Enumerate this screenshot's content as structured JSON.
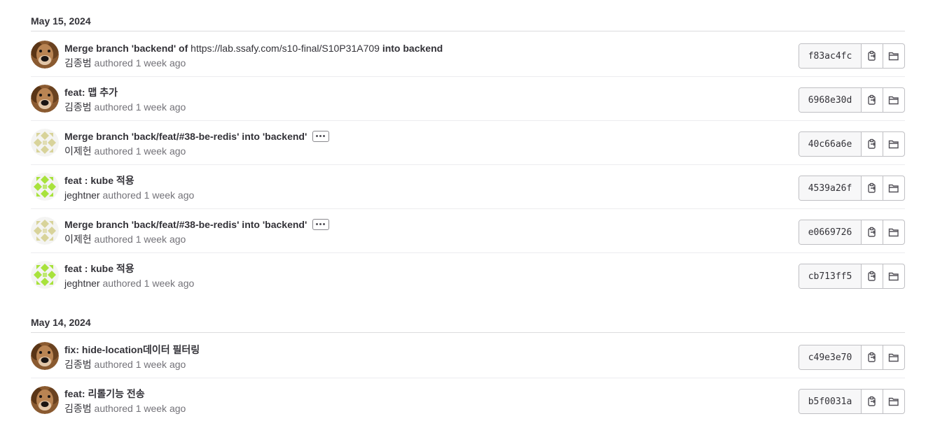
{
  "groups": [
    {
      "date": "May 15, 2024",
      "commits": [
        {
          "title_bold": "Merge branch 'backend' of",
          "title_link": "https://lab.ssafy.com/s10-final/S10P31A709",
          "title_tail": "into backend",
          "author": "김종범",
          "action": "authored",
          "time": "1 week ago",
          "sha": "f83ac4fc",
          "avatar": "dog-photo",
          "more_button": false
        },
        {
          "title_bold": "feat: 맵 추가",
          "title_link": "",
          "title_tail": "",
          "author": "김종범",
          "action": "authored",
          "time": "1 week ago",
          "sha": "6968e30d",
          "avatar": "dog-photo",
          "more_button": false
        },
        {
          "title_bold": "Merge branch 'back/feat/#38-be-redis' into 'backend'",
          "title_link": "",
          "title_tail": "",
          "author": "이제헌",
          "action": "authored",
          "time": "1 week ago",
          "sha": "40c66a6e",
          "avatar": "identicon-beige",
          "more_button": true
        },
        {
          "title_bold": "feat : kube 적용",
          "title_link": "",
          "title_tail": "",
          "author": "jeghtner",
          "action": "authored",
          "time": "1 week ago",
          "sha": "4539a26f",
          "avatar": "identicon-green",
          "more_button": false
        },
        {
          "title_bold": "Merge branch 'back/feat/#38-be-redis' into 'backend'",
          "title_link": "",
          "title_tail": "",
          "author": "이제헌",
          "action": "authored",
          "time": "1 week ago",
          "sha": "e0669726",
          "avatar": "identicon-beige",
          "more_button": true
        },
        {
          "title_bold": "feat : kube 적용",
          "title_link": "",
          "title_tail": "",
          "author": "jeghtner",
          "action": "authored",
          "time": "1 week ago",
          "sha": "cb713ff5",
          "avatar": "identicon-green",
          "more_button": false
        }
      ]
    },
    {
      "date": "May 14, 2024",
      "commits": [
        {
          "title_bold": "fix: hide-location데이터 필터링",
          "title_link": "",
          "title_tail": "",
          "author": "김종범",
          "action": "authored",
          "time": "1 week ago",
          "sha": "c49e3e70",
          "avatar": "dog-photo",
          "more_button": false
        },
        {
          "title_bold": "feat: 리롤기능 전송",
          "title_link": "",
          "title_tail": "",
          "author": "김종범",
          "action": "authored",
          "time": "1 week ago",
          "sha": "b5f0031a",
          "avatar": "dog-photo",
          "more_button": false
        }
      ]
    }
  ],
  "icons": {
    "copy": "copy-sha-icon",
    "browse": "browse-files-icon",
    "more": "ellipsis-icon"
  },
  "colors": {
    "identicon_beige": "#d8d39a",
    "identicon_green": "#a8e23c"
  }
}
